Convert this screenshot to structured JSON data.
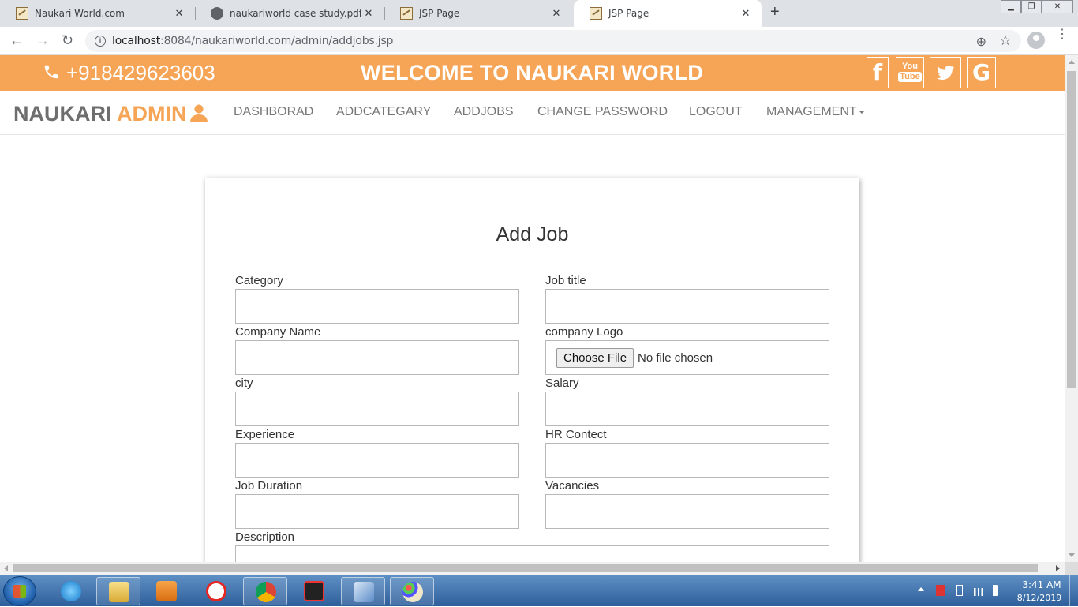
{
  "browser": {
    "tabs": [
      {
        "title": "Naukari World.com",
        "icon": "page-icon",
        "active": false
      },
      {
        "title": "naukariworld case study.pdf",
        "icon": "globe-icon",
        "active": false
      },
      {
        "title": "JSP Page",
        "icon": "page-icon",
        "active": false
      },
      {
        "title": "JSP Page",
        "icon": "page-icon",
        "active": true
      }
    ],
    "close_glyph": "✕",
    "new_tab_glyph": "+",
    "url_host": "localhost",
    "url_rest": ":8084/naukariworld.com/admin/addjobs.jsp"
  },
  "header": {
    "phone": "+918429623603",
    "welcome": "WELCOME TO NAUKARI WORLD",
    "accent_color": "#f6a557",
    "social_icons": [
      "facebook-icon",
      "youtube-icon",
      "twitter-icon",
      "google-icon"
    ]
  },
  "navbar": {
    "brand_main": "NAUKARI",
    "brand_accent": "ADMIN",
    "links": [
      "DASHBORAD",
      "ADDCATEGARY",
      "ADDJOBS",
      "CHANGE PASSWORD",
      "LOGOUT",
      "MANAGEMENT"
    ]
  },
  "form": {
    "title": "Add Job",
    "labels": {
      "category": "Category",
      "job_title": "Job title",
      "company_name": "Company Name",
      "company_logo": "company Logo",
      "city": "city",
      "salary": "Salary",
      "experience": "Experience",
      "hr_contact": "HR Contect",
      "job_duration": "Job Duration",
      "vacancies": "Vacancies",
      "description": "Description"
    },
    "values": {
      "category": "",
      "job_title": "",
      "company_name": "",
      "city": "",
      "salary": "",
      "experience": "",
      "hr_contact": "",
      "job_duration": "",
      "vacancies": "",
      "description": ""
    },
    "file_button": "Choose File",
    "file_status": "No file chosen"
  },
  "taskbar": {
    "apps": [
      "internet-explorer-icon",
      "file-explorer-icon",
      "media-player-icon",
      "yandex-icon",
      "chrome-icon",
      "msconfig-icon",
      "virtualbox-icon",
      "paint-icon"
    ],
    "time": "3:41 AM",
    "date": "8/12/2019"
  }
}
